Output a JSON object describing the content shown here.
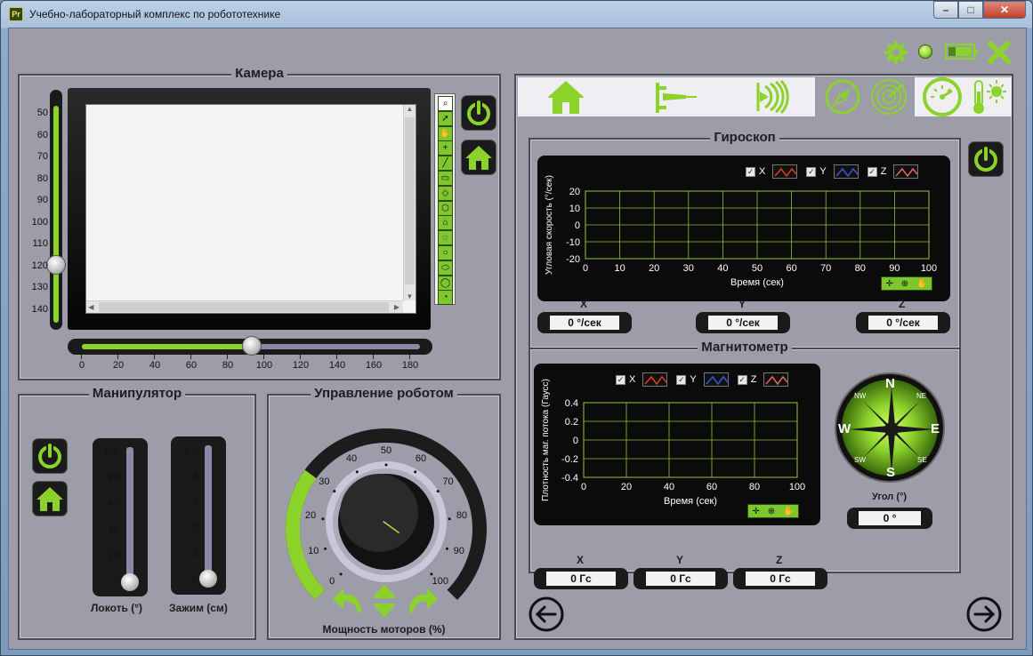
{
  "window": {
    "title": "Учебно-лабораторный комплекс по робототехнике",
    "min": "–",
    "max": "□",
    "close": "✕"
  },
  "topbar": {
    "icons": [
      "gear-icon",
      "status-led-icon",
      "battery-icon",
      "close-x-icon"
    ]
  },
  "camera": {
    "title": "Камера",
    "v_ticks": [
      "50",
      "60",
      "70",
      "80",
      "90",
      "100",
      "110",
      "120",
      "130",
      "140"
    ],
    "h_ticks": [
      "0",
      "20",
      "40",
      "60",
      "80",
      "100",
      "120",
      "140",
      "160",
      "180"
    ],
    "v_value": 120,
    "h_value": 90,
    "tools": [
      "zoom-tool-icon",
      "pointer-tool-icon",
      "pan-tool-icon",
      "point-tool-icon",
      "line-tool-icon",
      "rectangle-tool-icon",
      "rotated-rect-tool-icon",
      "polygon-tool-icon",
      "freehand-tool-icon",
      "annulus-tool-icon",
      "ellipse-tool-icon",
      "oval-tool-icon",
      "circle-tool-icon",
      "pie-tool-icon"
    ]
  },
  "manipulator": {
    "title": "Манипулятор",
    "elbow_label": "Локоть (°)",
    "elbow_ticks": [
      "100",
      "80",
      "60",
      "40",
      "20",
      "0"
    ],
    "elbow_value": 0,
    "grip_label": "Зажим (см)",
    "grip_ticks": [
      "5.5",
      "4",
      "3",
      "2",
      "1",
      "0"
    ],
    "grip_value": 0
  },
  "robot": {
    "title": "Управление роботом",
    "knob_label": "Мощность моторов (%)",
    "knob_ticks": [
      "0",
      "10",
      "20",
      "30",
      "40",
      "50",
      "60",
      "70",
      "80",
      "90",
      "100"
    ],
    "knob_value": 30
  },
  "tabs": [
    "home-icon",
    "ruler-sensor-icon",
    "sound-wave-icon",
    "compass-icon",
    "radar-icon",
    "gauge-icon",
    "temperature-icon"
  ],
  "gyro": {
    "title": "Гироскоп",
    "ylabel": "Угловая скорость (°/сек)",
    "xlabel": "Время (сек)",
    "legend": [
      "X",
      "Y",
      "Z"
    ],
    "readouts": [
      {
        "label": "X",
        "value": "0 °/сек"
      },
      {
        "label": "Y",
        "value": "0 °/сек"
      },
      {
        "label": "Z",
        "value": "0 °/сек"
      }
    ]
  },
  "magnet": {
    "title": "Магнитометр",
    "ylabel": "Плотность маг. потока (Гаусс)",
    "xlabel": "Время (сек)",
    "legend": [
      "X",
      "Y",
      "Z"
    ],
    "readouts": [
      {
        "label": "X",
        "value": "0 Гс"
      },
      {
        "label": "Y",
        "value": "0 Гс"
      },
      {
        "label": "Z",
        "value": "0 Гс"
      }
    ],
    "compass": {
      "N": "N",
      "S": "S",
      "E": "E",
      "W": "W",
      "NW": "NW",
      "NE": "NE",
      "SW": "SW",
      "SE": "SE"
    },
    "angle_label": "Угол (°)",
    "angle_value": "0 °"
  },
  "chart_data": [
    {
      "type": "line",
      "title": "",
      "xlabel": "Время (сек)",
      "ylabel": "Угловая скорость (°/сек)",
      "xlim": [
        0,
        100
      ],
      "ylim": [
        -20,
        20
      ],
      "x_ticks": [
        "0",
        "10",
        "20",
        "30",
        "40",
        "50",
        "60",
        "70",
        "80",
        "90",
        "100"
      ],
      "y_ticks": [
        "20",
        "10",
        "0",
        "-10",
        "-20"
      ],
      "y_tick_values": [
        20,
        10,
        0,
        -10,
        -20
      ],
      "grid": true,
      "legend": "top-right",
      "series": [
        {
          "name": "X",
          "values": []
        },
        {
          "name": "Y",
          "values": []
        },
        {
          "name": "Z",
          "values": []
        }
      ]
    },
    {
      "type": "line",
      "title": "",
      "xlabel": "Время (сек)",
      "ylabel": "Плотность маг. потока (Гаусс)",
      "xlim": [
        0,
        100
      ],
      "ylim": [
        -0.4,
        0.4
      ],
      "x_ticks": [
        "0",
        "20",
        "40",
        "60",
        "80",
        "100"
      ],
      "y_ticks": [
        "0.4",
        "0.2",
        "0",
        "-0.2",
        "-0.4"
      ],
      "y_tick_values": [
        0.4,
        0.2,
        0,
        -0.2,
        -0.4
      ],
      "grid": true,
      "legend": "top-right",
      "series": [
        {
          "name": "X",
          "values": []
        },
        {
          "name": "Y",
          "values": []
        },
        {
          "name": "Z",
          "values": []
        }
      ]
    }
  ],
  "colors": {
    "accent": "#8bd22b",
    "panel_bg": "#9d9ca9",
    "dark": "#111111",
    "grid": "#9ed24a",
    "x_series": "#e03a20",
    "y_series": "#3b57d6",
    "z_series": "#e06a55"
  }
}
